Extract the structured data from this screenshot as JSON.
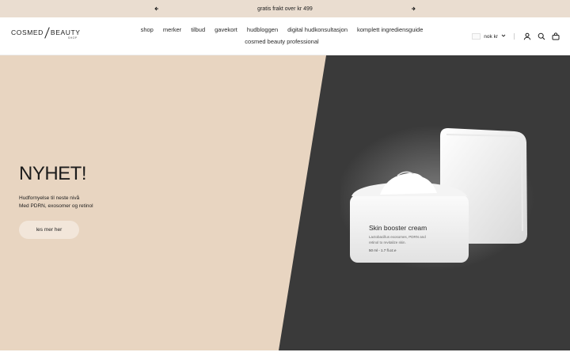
{
  "announcement": {
    "message": "gratis frakt over kr 499",
    "prev_icon": "arrow-left-icon",
    "next_icon": "arrow-right-icon"
  },
  "header": {
    "logo": {
      "left": "COSMED",
      "right": "BEAUTY",
      "sub": "SHOP"
    },
    "nav": [
      {
        "label": "shop"
      },
      {
        "label": "merker"
      },
      {
        "label": "tilbud"
      },
      {
        "label": "gavekort"
      },
      {
        "label": "hudbloggen"
      },
      {
        "label": "digital hudkonsultasjon"
      },
      {
        "label": "komplett ingrediensguide"
      },
      {
        "label": "cosmed beauty professional"
      }
    ],
    "currency": "nok kr",
    "icons": [
      "account-icon",
      "search-icon",
      "cart-icon"
    ]
  },
  "hero": {
    "title": "NYHET!",
    "line1": "Hudfornyelse til neste nivå",
    "line2": "Med PDRN, exosomer og retinol",
    "cta": "les mer her",
    "colors": {
      "left_bg": "#e8d5c1",
      "right_bg": "#3a3a3a",
      "cta_bg": "#f2e6da"
    },
    "product": {
      "name": "Skin booster cream",
      "desc1": "Lactobacillus exosomes, PDRN and",
      "desc2": "retinol to revitalize skin.",
      "size": "50 ml - 1.7 fl.oz.e"
    }
  }
}
